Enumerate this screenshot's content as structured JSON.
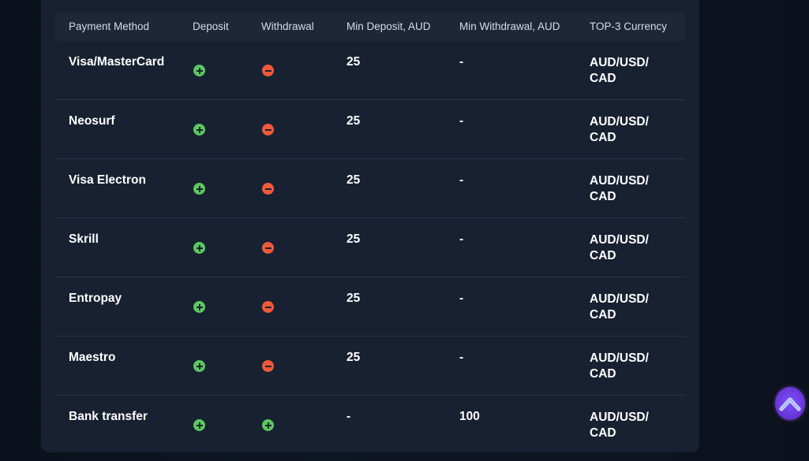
{
  "headers": {
    "method": "Payment Method",
    "deposit": "Deposit",
    "withdrawal": "Withdrawal",
    "min_deposit": "Min Deposit, AUD",
    "min_withdrawal": "Min Withdrawal, AUD",
    "currency": "TOP-3 Currency"
  },
  "rows": [
    {
      "method": "Visa/MasterCard",
      "deposit": "plus",
      "withdrawal": "minus",
      "min_deposit": "25",
      "min_withdrawal": "-",
      "currency_1": "AUD/USD/",
      "currency_2": "CAD"
    },
    {
      "method": "Neosurf",
      "deposit": "plus",
      "withdrawal": "minus",
      "min_deposit": "25",
      "min_withdrawal": "-",
      "currency_1": "AUD/USD/",
      "currency_2": "CAD"
    },
    {
      "method": "Visa Electron",
      "deposit": "plus",
      "withdrawal": "minus",
      "min_deposit": "25",
      "min_withdrawal": "-",
      "currency_1": "AUD/USD/",
      "currency_2": "CAD"
    },
    {
      "method": "Skrill",
      "deposit": "plus",
      "withdrawal": "minus",
      "min_deposit": "25",
      "min_withdrawal": "-",
      "currency_1": "AUD/USD/",
      "currency_2": "CAD"
    },
    {
      "method": "Entropay",
      "deposit": "plus",
      "withdrawal": "minus",
      "min_deposit": "25",
      "min_withdrawal": "-",
      "currency_1": "AUD/USD/",
      "currency_2": "CAD"
    },
    {
      "method": "Maestro",
      "deposit": "plus",
      "withdrawal": "minus",
      "min_deposit": "25",
      "min_withdrawal": "-",
      "currency_1": "AUD/USD/",
      "currency_2": "CAD"
    },
    {
      "method": "Bank transfer",
      "deposit": "plus",
      "withdrawal": "plus",
      "min_deposit": "-",
      "min_withdrawal": "100",
      "currency_1": "AUD/USD/",
      "currency_2": "CAD"
    }
  ],
  "colors": {
    "available": "#5bc95e",
    "unavailable": "#ef5a3b",
    "scroll_button": "#7c52ff"
  },
  "scroll_top_icon": "chevron-up-icon"
}
